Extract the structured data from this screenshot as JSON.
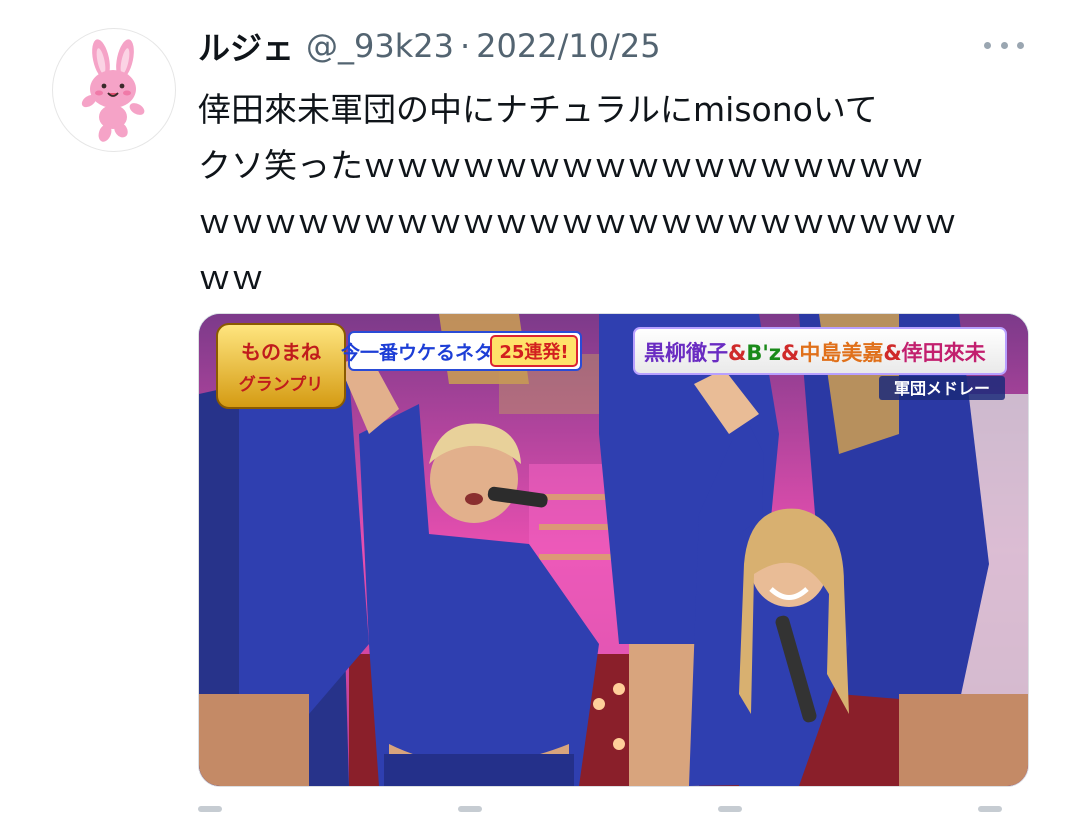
{
  "tweet": {
    "display_name": "ルジェ",
    "handle": "@_93k23",
    "separator": "·",
    "date": "2022/10/25",
    "text_lines": [
      "倖田來未軍団の中にナチュラルにmisonoいて",
      "クソ笑ったｗｗｗｗｗｗｗｗｗｗｗｗｗｗｗｗｗ",
      "ｗｗｗｗｗｗｗｗｗｗｗｗｗｗｗｗｗｗｗｗｗｗｗ",
      "ｗｗ"
    ]
  },
  "avatar": {
    "icon": "pink-rabbit-icon"
  },
  "media": {
    "logo_text": [
      "ものまね",
      "グランプリ"
    ],
    "banner_left": "今一番ウケるネタ",
    "banner_badge": "25連発!",
    "banner_right_parts": [
      "黒柳徹子",
      "&",
      "B'z",
      "&",
      "中島美嘉",
      "&",
      "倖田來未"
    ],
    "banner_sub": "軍団メドレー"
  },
  "colors": {
    "text": "#0f1419",
    "secondary": "#536471",
    "avatar_pink": "#f5a3c7",
    "costume_blue": "#2f3fb0",
    "stage_pink": "#e84fb0"
  }
}
